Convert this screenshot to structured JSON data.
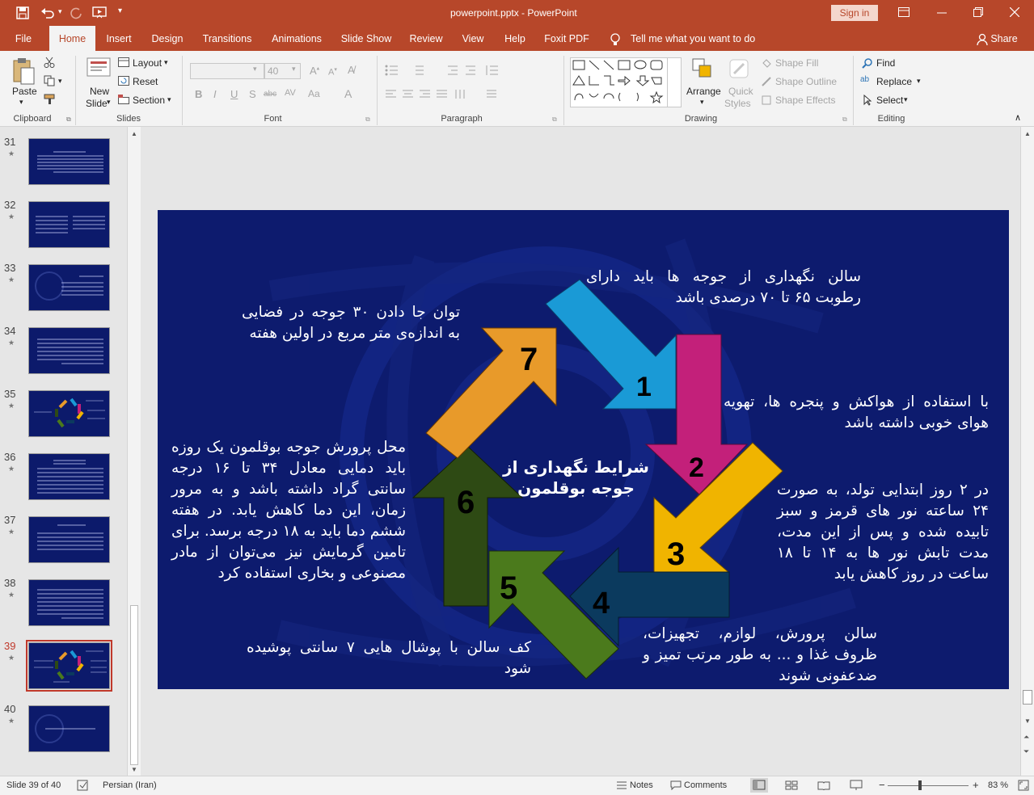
{
  "window": {
    "title": "powerpoint.pptx  -  PowerPoint",
    "signin": "Sign in",
    "share": "Share"
  },
  "tabs": [
    "File",
    "Home",
    "Insert",
    "Design",
    "Transitions",
    "Animations",
    "Slide Show",
    "Review",
    "View",
    "Help",
    "Foxit PDF"
  ],
  "tell_me": "Tell me what you want to do",
  "ribbon": {
    "clipboard": {
      "paste": "Paste",
      "label": "Clipboard"
    },
    "slides": {
      "new_slide_1": "New",
      "new_slide_2": "Slide",
      "layout": "Layout",
      "reset": "Reset",
      "section": "Section",
      "label": "Slides"
    },
    "font": {
      "font_name": "",
      "font_size": "40",
      "label": "Font"
    },
    "paragraph": {
      "label": "Paragraph"
    },
    "drawing": {
      "arrange": "Arrange",
      "quick_styles_1": "Quick",
      "quick_styles_2": "Styles",
      "shape_fill": "Shape Fill",
      "shape_outline": "Shape Outline",
      "shape_effects": "Shape Effects",
      "label": "Drawing"
    },
    "editing": {
      "find": "Find",
      "replace": "Replace",
      "select": "Select",
      "label": "Editing"
    }
  },
  "thumbnails": [
    {
      "num": "31",
      "selected": false
    },
    {
      "num": "32",
      "selected": false
    },
    {
      "num": "33",
      "selected": false
    },
    {
      "num": "34",
      "selected": false
    },
    {
      "num": "35",
      "selected": false
    },
    {
      "num": "36",
      "selected": false
    },
    {
      "num": "37",
      "selected": false
    },
    {
      "num": "38",
      "selected": false
    },
    {
      "num": "39",
      "selected": true
    },
    {
      "num": "40",
      "selected": false
    }
  ],
  "slide": {
    "center_title": "شرایط نگهداری از جوجه بوقلمون",
    "arrow_numbers": [
      "1",
      "2",
      "3",
      "4",
      "5",
      "6",
      "7"
    ],
    "text1": "سالن نگهداری از جوجه ها باید دارای رطوبت ۶۵ تا ۷۰ درصدی باشد",
    "text2": "با استفاده از هواکش و پنجره ها، تهویه هوای خوبی داشته باشد",
    "text3": "در ۲ روز ابتدایی تولد، به صورت ۲۴ ساعته نور های قرمز و سبز تابیده شده و پس از این مدت، مدت تابش نور ها به ۱۴ تا ۱۸ ساعت در روز کاهش یابد",
    "text4": "سالن پرورش، لوازم، تجهیزات، ظروف غذا و ... به طور مرتب تمیز و ضدعفونی شوند",
    "text5": "کف سالن با پوشال هایی ۷ سانتی پوشیده شود",
    "text6": "محل پرورش جوجه بوقلمون یک روزه باید دمایی معادل ۳۴ تا ۱۶ درجه سانتی گراد داشته باشد و به مرور زمان، این دما کاهش یابد. در هفته ششم دما باید به ۱۸ درجه برسد. برای تامین گرمایش نیز می‌توان از مادر مصنوعی و بخاری استفاده کرد",
    "text7": "توان جا دادن ۳۰ جوجه در فضایی به اندازه‌ی متر مربع در اولین هفته"
  },
  "status": {
    "slide_info": "Slide 39 of 40",
    "language": "Persian (Iran)",
    "notes": "Notes",
    "comments": "Comments",
    "zoom": "83 %"
  },
  "colors": {
    "accent": "#b7472a",
    "slide_bg": "#0d1b6e",
    "arrow1": "#1a9ad6",
    "arrow2": "#c3207a",
    "arrow3": "#f0b400",
    "arrow4": "#0b3a5e",
    "arrow5": "#4b7a1c",
    "arrow6": "#2e4a14",
    "arrow7": "#e89a2a"
  }
}
